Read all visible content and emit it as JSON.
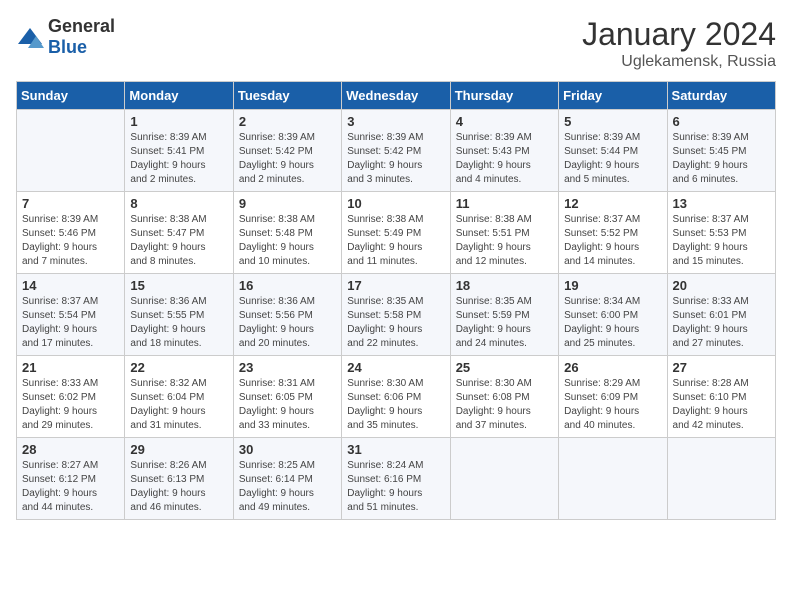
{
  "logo": {
    "general": "General",
    "blue": "Blue"
  },
  "title": "January 2024",
  "location": "Uglekamensk, Russia",
  "days_of_week": [
    "Sunday",
    "Monday",
    "Tuesday",
    "Wednesday",
    "Thursday",
    "Friday",
    "Saturday"
  ],
  "weeks": [
    [
      {
        "day": "",
        "info": ""
      },
      {
        "day": "1",
        "info": "Sunrise: 8:39 AM\nSunset: 5:41 PM\nDaylight: 9 hours\nand 2 minutes."
      },
      {
        "day": "2",
        "info": "Sunrise: 8:39 AM\nSunset: 5:42 PM\nDaylight: 9 hours\nand 2 minutes."
      },
      {
        "day": "3",
        "info": "Sunrise: 8:39 AM\nSunset: 5:42 PM\nDaylight: 9 hours\nand 3 minutes."
      },
      {
        "day": "4",
        "info": "Sunrise: 8:39 AM\nSunset: 5:43 PM\nDaylight: 9 hours\nand 4 minutes."
      },
      {
        "day": "5",
        "info": "Sunrise: 8:39 AM\nSunset: 5:44 PM\nDaylight: 9 hours\nand 5 minutes."
      },
      {
        "day": "6",
        "info": "Sunrise: 8:39 AM\nSunset: 5:45 PM\nDaylight: 9 hours\nand 6 minutes."
      }
    ],
    [
      {
        "day": "7",
        "info": "Sunrise: 8:39 AM\nSunset: 5:46 PM\nDaylight: 9 hours\nand 7 minutes."
      },
      {
        "day": "8",
        "info": "Sunrise: 8:38 AM\nSunset: 5:47 PM\nDaylight: 9 hours\nand 8 minutes."
      },
      {
        "day": "9",
        "info": "Sunrise: 8:38 AM\nSunset: 5:48 PM\nDaylight: 9 hours\nand 10 minutes."
      },
      {
        "day": "10",
        "info": "Sunrise: 8:38 AM\nSunset: 5:49 PM\nDaylight: 9 hours\nand 11 minutes."
      },
      {
        "day": "11",
        "info": "Sunrise: 8:38 AM\nSunset: 5:51 PM\nDaylight: 9 hours\nand 12 minutes."
      },
      {
        "day": "12",
        "info": "Sunrise: 8:37 AM\nSunset: 5:52 PM\nDaylight: 9 hours\nand 14 minutes."
      },
      {
        "day": "13",
        "info": "Sunrise: 8:37 AM\nSunset: 5:53 PM\nDaylight: 9 hours\nand 15 minutes."
      }
    ],
    [
      {
        "day": "14",
        "info": "Sunrise: 8:37 AM\nSunset: 5:54 PM\nDaylight: 9 hours\nand 17 minutes."
      },
      {
        "day": "15",
        "info": "Sunrise: 8:36 AM\nSunset: 5:55 PM\nDaylight: 9 hours\nand 18 minutes."
      },
      {
        "day": "16",
        "info": "Sunrise: 8:36 AM\nSunset: 5:56 PM\nDaylight: 9 hours\nand 20 minutes."
      },
      {
        "day": "17",
        "info": "Sunrise: 8:35 AM\nSunset: 5:58 PM\nDaylight: 9 hours\nand 22 minutes."
      },
      {
        "day": "18",
        "info": "Sunrise: 8:35 AM\nSunset: 5:59 PM\nDaylight: 9 hours\nand 24 minutes."
      },
      {
        "day": "19",
        "info": "Sunrise: 8:34 AM\nSunset: 6:00 PM\nDaylight: 9 hours\nand 25 minutes."
      },
      {
        "day": "20",
        "info": "Sunrise: 8:33 AM\nSunset: 6:01 PM\nDaylight: 9 hours\nand 27 minutes."
      }
    ],
    [
      {
        "day": "21",
        "info": "Sunrise: 8:33 AM\nSunset: 6:02 PM\nDaylight: 9 hours\nand 29 minutes."
      },
      {
        "day": "22",
        "info": "Sunrise: 8:32 AM\nSunset: 6:04 PM\nDaylight: 9 hours\nand 31 minutes."
      },
      {
        "day": "23",
        "info": "Sunrise: 8:31 AM\nSunset: 6:05 PM\nDaylight: 9 hours\nand 33 minutes."
      },
      {
        "day": "24",
        "info": "Sunrise: 8:30 AM\nSunset: 6:06 PM\nDaylight: 9 hours\nand 35 minutes."
      },
      {
        "day": "25",
        "info": "Sunrise: 8:30 AM\nSunset: 6:08 PM\nDaylight: 9 hours\nand 37 minutes."
      },
      {
        "day": "26",
        "info": "Sunrise: 8:29 AM\nSunset: 6:09 PM\nDaylight: 9 hours\nand 40 minutes."
      },
      {
        "day": "27",
        "info": "Sunrise: 8:28 AM\nSunset: 6:10 PM\nDaylight: 9 hours\nand 42 minutes."
      }
    ],
    [
      {
        "day": "28",
        "info": "Sunrise: 8:27 AM\nSunset: 6:12 PM\nDaylight: 9 hours\nand 44 minutes."
      },
      {
        "day": "29",
        "info": "Sunrise: 8:26 AM\nSunset: 6:13 PM\nDaylight: 9 hours\nand 46 minutes."
      },
      {
        "day": "30",
        "info": "Sunrise: 8:25 AM\nSunset: 6:14 PM\nDaylight: 9 hours\nand 49 minutes."
      },
      {
        "day": "31",
        "info": "Sunrise: 8:24 AM\nSunset: 6:16 PM\nDaylight: 9 hours\nand 51 minutes."
      },
      {
        "day": "",
        "info": ""
      },
      {
        "day": "",
        "info": ""
      },
      {
        "day": "",
        "info": ""
      }
    ]
  ]
}
